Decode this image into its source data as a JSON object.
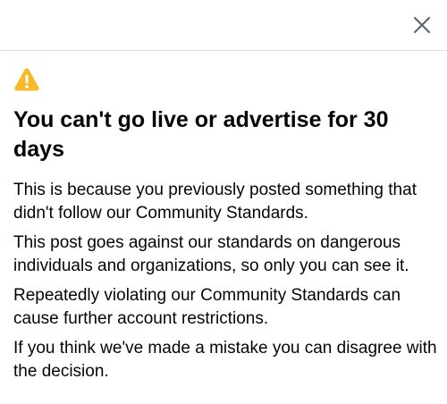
{
  "header": {
    "close_icon": "close-icon"
  },
  "warning": {
    "icon": "warning-triangle-icon",
    "color": "#f7b928"
  },
  "dialog": {
    "title": "You can't go live or advertise for 30 days",
    "paragraphs": [
      "This is because you previously posted something that didn't follow our Community Standards.",
      "This post goes against our standards on dangerous individuals and organizations, so only you can see it.",
      "Repeatedly violating our Community Standards can cause further account restrictions.",
      "If you think we've made a mistake you can disagree with the decision."
    ]
  }
}
